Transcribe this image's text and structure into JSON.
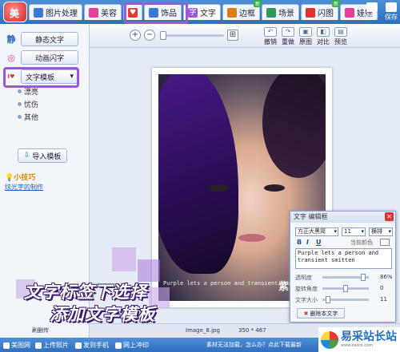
{
  "app": {
    "logo_text": "美"
  },
  "tabs": [
    {
      "label": "图片处理",
      "icon": "photo-icon",
      "color": "#3a7bd5"
    },
    {
      "label": "美容",
      "icon": "beauty-icon",
      "color": "#e0409a"
    },
    {
      "label": "",
      "icon": "heart-icon",
      "color": "#e53935"
    },
    {
      "label": "饰品",
      "icon": "accessory-icon",
      "color": "#3a7bd5"
    },
    {
      "label": "文字",
      "icon": "text-icon",
      "color": "#9b59d6"
    },
    {
      "label": "边框",
      "icon": "frame-icon",
      "color": "#e07b1a"
    },
    {
      "label": "场景",
      "icon": "scene-icon",
      "color": "#2e9b57"
    },
    {
      "label": "闪图",
      "icon": "flash-icon",
      "color": "#d33"
    },
    {
      "label": "娃娃",
      "icon": "doll-icon",
      "color": "#e0409a"
    }
  ],
  "top_actions": {
    "open": "打开",
    "save": "保存"
  },
  "left_panel": {
    "static_text": "静态文字",
    "anim_text": "动画闪字",
    "template_dropdown": "文字模板",
    "sub_items": [
      "漂亮",
      "忧伤",
      "其他"
    ],
    "import_button": "导入模板",
    "tip_title": "小技巧",
    "tip_link": "炫光字的制作",
    "static_icon": "静"
  },
  "toolbar": {
    "zoom_in": "+",
    "zoom_out": "−",
    "actions": [
      {
        "label": "撤销",
        "icon": "undo-icon"
      },
      {
        "label": "重做",
        "icon": "redo-icon"
      },
      {
        "label": "原图",
        "icon": "original-icon"
      },
      {
        "label": "对比",
        "icon": "compare-icon"
      },
      {
        "label": "预览",
        "icon": "preview-icon"
      }
    ]
  },
  "photo": {
    "overlay_text": "Purple lets a person and transient smitten",
    "deco_text": "紫色"
  },
  "caption": {
    "line1": "文字标签下选择",
    "line2": "添加文字模板"
  },
  "editor": {
    "title": "文字 编辑框",
    "font": "方正大黑简",
    "size": "11",
    "orient": "横排",
    "bold": "B",
    "italic": "I",
    "underline": "U",
    "color_label": "当前颜色",
    "text": "Purple lets a person and transient smitten",
    "opacity_label": "透明度",
    "opacity_value": "86%",
    "rotate_label": "旋转角度",
    "rotate_value": "0",
    "size_label": "文字大小",
    "size_value": "11",
    "delete_button": "删除本文字"
  },
  "status": {
    "filename": "Image_8.jpg",
    "dims": "350 * 467",
    "left_hint": "刷删传"
  },
  "bottombar": {
    "items": [
      "美图网",
      "上传照片",
      "发到手机",
      "网上冲印"
    ],
    "middle": "素材无法加载，怎么办？点此下载最新"
  },
  "watermark": {
    "title": "易采站长站",
    "url": "www.easck.com"
  }
}
